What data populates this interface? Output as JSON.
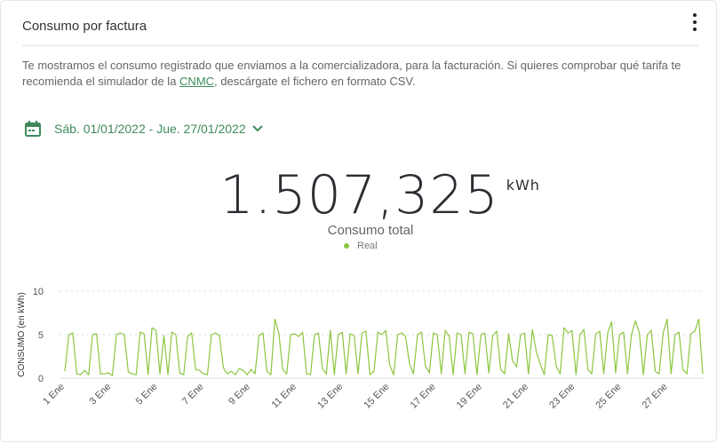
{
  "header": {
    "title": "Consumo por factura",
    "menu_icon": "more-vertical-icon"
  },
  "description": {
    "text_before": "Te mostramos el consumo registrado que enviamos a la comercializadora, para la facturación. Si quieres comprobar qué tarifa te recomienda el simulador de la ",
    "link": "CNMC",
    "text_after": ", descárgate el fichero en formato CSV."
  },
  "date_range": {
    "label": "Sáb. 01/01/2022 - Jue. 27/01/2022",
    "icon": "calendar-icon"
  },
  "summary": {
    "value": "1.507,325",
    "unit": "kWh",
    "label": "Consumo total"
  },
  "colors": {
    "accent": "#3f8a5c",
    "series": "#8cc63f",
    "text": "#2c2c33"
  },
  "chart_data": {
    "type": "line",
    "ylabel": "CONSUMO (en kWh)",
    "ylim": [
      0,
      10
    ],
    "yticks": [
      "0",
      "5",
      "10"
    ],
    "xtick_labels": [
      "1 Ene",
      "3 Ene",
      "5 Ene",
      "7 Ene",
      "9 Ene",
      "11 Ene",
      "13 Ene",
      "15 Ene",
      "17 Ene",
      "19 Ene",
      "21 Ene",
      "23 Ene",
      "25 Ene",
      "27 Ene"
    ],
    "grid": true,
    "legend": "top-center",
    "series": [
      {
        "name": "Real",
        "values": [
          0.8,
          5.0,
          5.2,
          0.5,
          0.4,
          0.9,
          0.4,
          5.0,
          5.1,
          0.5,
          0.5,
          0.6,
          0.3,
          5.0,
          5.2,
          5.0,
          0.7,
          0.5,
          0.4,
          5.3,
          5.1,
          0.4,
          5.8,
          5.5,
          0.5,
          4.9,
          0.4,
          5.3,
          5.0,
          0.6,
          0.4,
          4.8,
          5.2,
          1.0,
          0.9,
          0.5,
          0.4,
          5.0,
          5.2,
          4.9,
          1.2,
          0.5,
          0.8,
          0.4,
          1.1,
          0.9,
          0.4,
          1.0,
          0.5,
          4.9,
          5.2,
          0.8,
          0.4,
          6.8,
          5.2,
          1.0,
          0.5,
          5.0,
          5.1,
          4.8,
          5.3,
          0.5,
          0.4,
          5.0,
          5.2,
          1.1,
          0.5,
          5.5,
          0.4,
          5.0,
          5.3,
          0.5,
          5.1,
          4.9,
          0.5,
          5.2,
          5.4,
          0.4,
          0.8,
          5.3,
          5.0,
          5.5,
          1.5,
          0.4,
          5.0,
          5.2,
          4.8,
          1.6,
          0.5,
          5.0,
          5.3,
          1.4,
          0.6,
          5.2,
          5.0,
          0.5,
          5.5,
          4.8,
          0.4,
          5.2,
          5.0,
          0.5,
          5.3,
          5.1,
          0.4,
          5.0,
          5.2,
          0.6,
          4.9,
          5.4,
          1.0,
          0.5,
          5.1,
          2.0,
          1.3,
          5.0,
          5.2,
          0.5,
          5.6,
          3.0,
          1.6,
          0.4,
          5.0,
          4.9,
          1.4,
          0.5,
          5.8,
          5.2,
          5.5,
          0.4,
          5.0,
          5.6,
          1.0,
          0.5,
          5.1,
          5.4,
          0.5,
          5.2,
          6.5,
          0.6,
          5.0,
          5.3,
          0.5,
          5.0,
          6.6,
          5.2,
          0.4,
          5.0,
          5.5,
          0.8,
          0.5,
          5.2,
          6.8,
          0.5,
          5.0,
          5.3,
          1.0,
          0.5,
          5.1,
          5.4,
          6.8,
          0.5
        ]
      }
    ]
  }
}
